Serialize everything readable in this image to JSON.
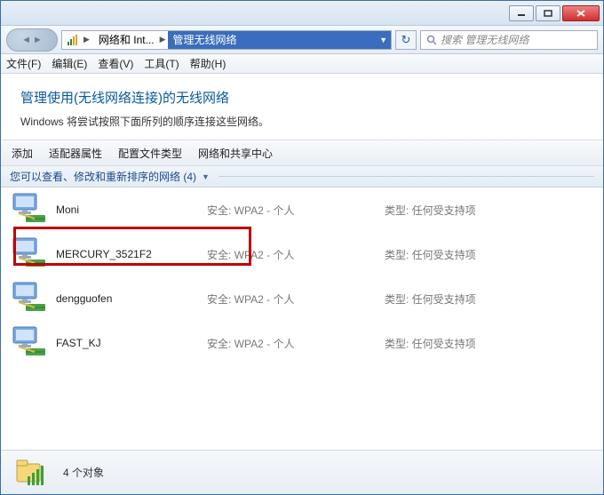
{
  "titlebar": {
    "minimize_tip": "最小化",
    "maximize_tip": "最大化",
    "close_tip": "关闭"
  },
  "address": {
    "segment1": "网络和 Int...",
    "segment2": "管理无线网络"
  },
  "search": {
    "placeholder": "搜索 管理无线网络"
  },
  "menubar": {
    "file": "文件(F)",
    "edit": "编辑(E)",
    "view": "查看(V)",
    "tools": "工具(T)",
    "help": "帮助(H)"
  },
  "header": {
    "title": "管理使用(无线网络连接)的无线网络",
    "subtitle": "Windows 将尝试按照下面所列的顺序连接这些网络。"
  },
  "toolbar": {
    "add": "添加",
    "adapter": "适配器属性",
    "profiletype": "配置文件类型",
    "sharing": "网络和共享中心"
  },
  "grouphdr": {
    "text": "您可以查看、修改和重新排序的网络 (4)"
  },
  "networks": [
    {
      "name": "Moni",
      "security": "安全: WPA2 - 个人",
      "type": "类型: 任何受支持项"
    },
    {
      "name": "MERCURY_3521F2",
      "security": "安全: WPA2 - 个人",
      "type": "类型: 任何受支持项"
    },
    {
      "name": "dengguofen",
      "security": "安全: WPA2 - 个人",
      "type": "类型: 任何受支持项"
    },
    {
      "name": "FAST_KJ",
      "security": "安全: WPA2 - 个人",
      "type": "类型: 任何受支持项"
    }
  ],
  "statusbar": {
    "count": "4 个对象"
  }
}
